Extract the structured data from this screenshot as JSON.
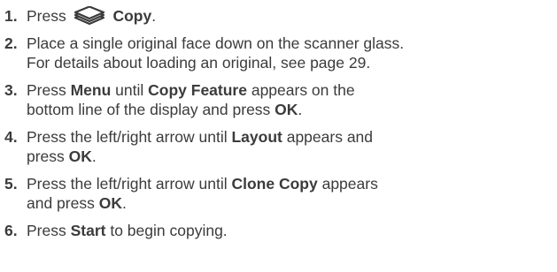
{
  "steps": [
    {
      "number": "1.",
      "parts": [
        {
          "t": "text",
          "v": "Press "
        },
        {
          "t": "icon",
          "v": "copy-icon"
        },
        {
          "t": "bold",
          "v": " Copy"
        },
        {
          "t": "text",
          "v": "."
        }
      ]
    },
    {
      "number": "2.",
      "parts": [
        {
          "t": "text",
          "v": "Place a single original face down on the scanner glass."
        },
        {
          "t": "br"
        },
        {
          "t": "text",
          "v": "For details about loading an original, see page 29."
        }
      ]
    },
    {
      "number": "3.",
      "parts": [
        {
          "t": "text",
          "v": "Press "
        },
        {
          "t": "bold",
          "v": "Menu"
        },
        {
          "t": "text",
          "v": " until "
        },
        {
          "t": "bold",
          "v": "Copy Feature"
        },
        {
          "t": "text",
          "v": " appears on the"
        },
        {
          "t": "br"
        },
        {
          "t": "text",
          "v": "bottom line of the display and press "
        },
        {
          "t": "bold",
          "v": "OK"
        },
        {
          "t": "text",
          "v": "."
        }
      ]
    },
    {
      "number": "4.",
      "parts": [
        {
          "t": "text",
          "v": "Press the left/right arrow until "
        },
        {
          "t": "bold",
          "v": "Layout"
        },
        {
          "t": "text",
          "v": " appears and"
        },
        {
          "t": "br"
        },
        {
          "t": "text",
          "v": "press "
        },
        {
          "t": "bold",
          "v": "OK"
        },
        {
          "t": "text",
          "v": "."
        }
      ]
    },
    {
      "number": "5.",
      "parts": [
        {
          "t": "text",
          "v": "Press the left/right arrow until "
        },
        {
          "t": "bold",
          "v": "Clone Copy"
        },
        {
          "t": "text",
          "v": " appears"
        },
        {
          "t": "br"
        },
        {
          "t": "text",
          "v": "and press "
        },
        {
          "t": "bold",
          "v": "OK"
        },
        {
          "t": "text",
          "v": "."
        }
      ]
    },
    {
      "number": "6.",
      "parts": [
        {
          "t": "text",
          "v": "Press "
        },
        {
          "t": "bold",
          "v": "Start"
        },
        {
          "t": "text",
          "v": " to begin copying."
        }
      ]
    }
  ]
}
